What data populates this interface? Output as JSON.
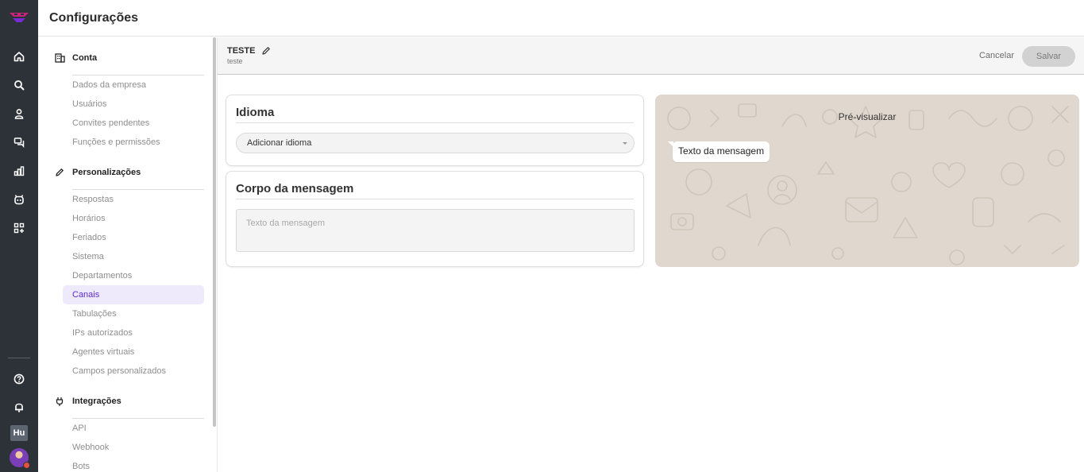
{
  "header": {
    "title": "Configurações"
  },
  "rail": {
    "items": [
      "home-icon",
      "search-icon",
      "contacts-icon",
      "chats-icon",
      "reports-icon",
      "bot-icon",
      "apps-icon"
    ],
    "bottom": [
      "help-icon",
      "bell-icon"
    ],
    "workspace": "Hu"
  },
  "settings_nav": {
    "sections": [
      {
        "title": "Conta",
        "icon": "building-icon",
        "items": [
          "Dados da empresa",
          "Usuários",
          "Convites pendentes",
          "Funções e permissões"
        ]
      },
      {
        "title": "Personalizações",
        "icon": "pencil-icon",
        "items": [
          "Respostas",
          "Horários",
          "Feriados",
          "Sistema",
          "Departamentos",
          "Canais",
          "Tabulações",
          "IPs autorizados",
          "Agentes virtuais",
          "Campos personalizados"
        ]
      },
      {
        "title": "Integrações",
        "icon": "plug-icon",
        "items": [
          "API",
          "Webhook",
          "Bots"
        ]
      }
    ],
    "active_item": "Canais"
  },
  "content_header": {
    "title": "TESTE",
    "subtitle": "teste",
    "cancel_label": "Cancelar",
    "save_label": "Salvar"
  },
  "language_card": {
    "title": "Idioma",
    "select_value": "Adicionar idioma"
  },
  "body_card": {
    "title": "Corpo da mensagem",
    "placeholder": "Texto da mensagem"
  },
  "preview": {
    "title": "Pré-visualizar",
    "bubble_text": "Texto da mensagem"
  },
  "colors": {
    "rail_bg": "#2c3238",
    "accent": "#5b2bd0",
    "active_bg": "#efeafb",
    "preview_bg": "#e0d8cf"
  }
}
